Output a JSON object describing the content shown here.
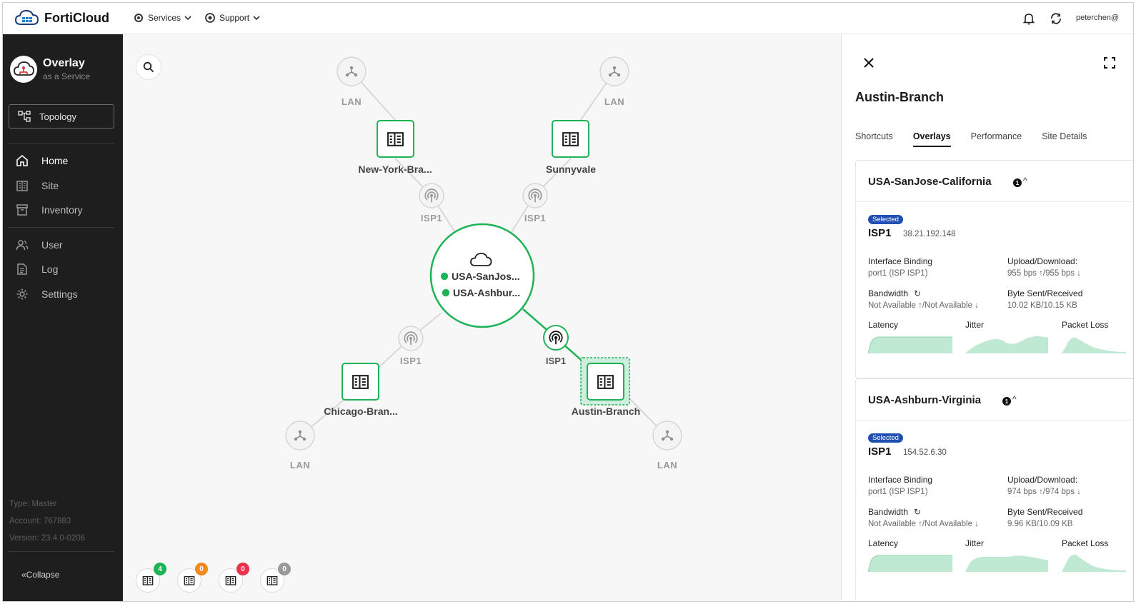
{
  "topbar": {
    "logo": "FortiCloud",
    "menus": [
      {
        "label": "Services"
      },
      {
        "label": "Support"
      }
    ],
    "user": "peterchen@"
  },
  "sidebar": {
    "brand_title": "Overlay",
    "brand_sub": "as a Service",
    "topology_button": "Topology",
    "items": [
      {
        "label": "Home",
        "icon": "home-icon",
        "active": true
      },
      {
        "label": "Site",
        "icon": "building-icon"
      },
      {
        "label": "Inventory",
        "icon": "archive-icon"
      },
      {
        "label": "User",
        "icon": "users-icon"
      },
      {
        "label": "Log",
        "icon": "document-icon"
      },
      {
        "label": "Settings",
        "icon": "gear-icon"
      }
    ],
    "meta": {
      "type": "Type: Master",
      "account": "Account: 767883",
      "version": "Version: 23.4.0-0206"
    },
    "collapse": "«Collapse"
  },
  "topology": {
    "hub": {
      "overlays": [
        "USA-SanJos...",
        "USA-Ashbur..."
      ],
      "status_color": "#1fb257"
    },
    "sites": [
      {
        "name": "New-York-Bra...",
        "isp": "ISP1",
        "lan": "LAN"
      },
      {
        "name": "Sunnyvale",
        "isp": "ISP1",
        "lan": "LAN"
      },
      {
        "name": "Chicago-Bran...",
        "isp": "ISP1",
        "lan": "LAN"
      },
      {
        "name": "Austin-Branch",
        "isp": "ISP1",
        "lan": "LAN",
        "selected": true
      }
    ],
    "badges": [
      {
        "count": "4",
        "color": "#1fb257"
      },
      {
        "count": "0",
        "color": "#f08a1c"
      },
      {
        "count": "0",
        "color": "#e8314b"
      },
      {
        "count": "0",
        "color": "#9a9a9a"
      }
    ],
    "accent": "#1fb257"
  },
  "panel": {
    "title": "Austin-Branch",
    "tabs": [
      {
        "label": "Shortcuts"
      },
      {
        "label": "Overlays",
        "active": true
      },
      {
        "label": "Performance"
      },
      {
        "label": "Site Details"
      }
    ],
    "overlays": [
      {
        "name": "USA-SanJose-California",
        "count": "1",
        "selected_badge": "Selected",
        "isp": "ISP1",
        "ip": "38.21.192.148",
        "interface_binding_label": "Interface Binding",
        "interface_binding": "port1 (ISP ISP1)",
        "updown_label": "Upload/Download:",
        "updown": "955 bps ↑/955 bps ↓",
        "bandwidth_label": "Bandwidth",
        "bandwidth": "Not Available ↑/Not Available ↓",
        "bytes_label": "Byte Sent/Received",
        "bytes": "10.02 KB/10.15 KB",
        "latency_label": "Latency",
        "jitter_label": "Jitter",
        "loss_label": "Packet Loss"
      },
      {
        "name": "USA-Ashburn-Virginia",
        "count": "1",
        "selected_badge": "Selected",
        "isp": "ISP1",
        "ip": "154.52.6.30",
        "interface_binding_label": "Interface Binding",
        "interface_binding": "port1 (ISP ISP1)",
        "updown_label": "Upload/Download:",
        "updown": "974 bps ↑/974 bps ↓",
        "bandwidth_label": "Bandwidth",
        "bandwidth": "Not Available ↑/Not Available ↓",
        "bytes_label": "Byte Sent/Received",
        "bytes": "9.96 KB/10.09 KB",
        "latency_label": "Latency",
        "jitter_label": "Jitter",
        "loss_label": "Packet Loss"
      }
    ],
    "spark_color": "#bfe9d2"
  }
}
